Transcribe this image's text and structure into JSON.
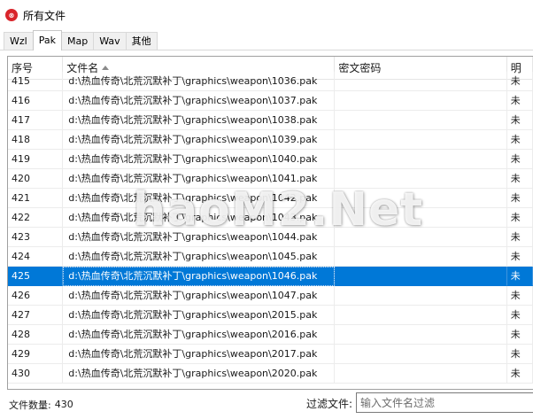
{
  "window": {
    "title": "所有文件",
    "icon": "app-logo-icon"
  },
  "tabs": [
    {
      "label": "Wzl",
      "active": false
    },
    {
      "label": "Pak",
      "active": true
    },
    {
      "label": "Map",
      "active": false
    },
    {
      "label": "Wav",
      "active": false
    },
    {
      "label": "其他",
      "active": false
    }
  ],
  "list": {
    "columns": [
      "序号",
      "文件名",
      "密文密码",
      "明"
    ],
    "sort_icon": "sort-ascending-icon",
    "rows": [
      {
        "index": "415",
        "filename": "d:\\热血传奇\\北荒沉默补丁\\graphics\\weapon\\1036.pak",
        "password": "",
        "extra": "未"
      },
      {
        "index": "416",
        "filename": "d:\\热血传奇\\北荒沉默补丁\\graphics\\weapon\\1037.pak",
        "password": "",
        "extra": "未"
      },
      {
        "index": "417",
        "filename": "d:\\热血传奇\\北荒沉默补丁\\graphics\\weapon\\1038.pak",
        "password": "",
        "extra": "未"
      },
      {
        "index": "418",
        "filename": "d:\\热血传奇\\北荒沉默补丁\\graphics\\weapon\\1039.pak",
        "password": "",
        "extra": "未"
      },
      {
        "index": "419",
        "filename": "d:\\热血传奇\\北荒沉默补丁\\graphics\\weapon\\1040.pak",
        "password": "",
        "extra": "未"
      },
      {
        "index": "420",
        "filename": "d:\\热血传奇\\北荒沉默补丁\\graphics\\weapon\\1041.pak",
        "password": "",
        "extra": "未"
      },
      {
        "index": "421",
        "filename": "d:\\热血传奇\\北荒沉默补丁\\graphics\\weapon\\1042.pak",
        "password": "",
        "extra": "未"
      },
      {
        "index": "422",
        "filename": "d:\\热血传奇\\北荒沉默补丁\\graphics\\weapon\\1043.pak",
        "password": "",
        "extra": "未"
      },
      {
        "index": "423",
        "filename": "d:\\热血传奇\\北荒沉默补丁\\graphics\\weapon\\1044.pak",
        "password": "",
        "extra": "未"
      },
      {
        "index": "424",
        "filename": "d:\\热血传奇\\北荒沉默补丁\\graphics\\weapon\\1045.pak",
        "password": "",
        "extra": "未"
      },
      {
        "index": "425",
        "filename": "d:\\热血传奇\\北荒沉默补丁\\graphics\\weapon\\1046.pak",
        "password": "",
        "extra": "未",
        "selected": true
      },
      {
        "index": "426",
        "filename": "d:\\热血传奇\\北荒沉默补丁\\graphics\\weapon\\1047.pak",
        "password": "",
        "extra": "未"
      },
      {
        "index": "427",
        "filename": "d:\\热血传奇\\北荒沉默补丁\\graphics\\weapon\\2015.pak",
        "password": "",
        "extra": "未"
      },
      {
        "index": "428",
        "filename": "d:\\热血传奇\\北荒沉默补丁\\graphics\\weapon\\2016.pak",
        "password": "",
        "extra": "未"
      },
      {
        "index": "429",
        "filename": "d:\\热血传奇\\北荒沉默补丁\\graphics\\weapon\\2017.pak",
        "password": "",
        "extra": "未"
      },
      {
        "index": "430",
        "filename": "d:\\热血传奇\\北荒沉默补丁\\graphics\\weapon\\2020.pak",
        "password": "",
        "extra": "未"
      }
    ]
  },
  "watermark": {
    "text": "haoM2.Net"
  },
  "status": {
    "count_label": "文件数量:",
    "count_value": "430",
    "filter_label": "过滤文件:",
    "filter_placeholder": "输入文件名过滤",
    "filter_value": ""
  },
  "colors": {
    "selection": "#0078d7",
    "accent_icon": "#d9252b"
  }
}
